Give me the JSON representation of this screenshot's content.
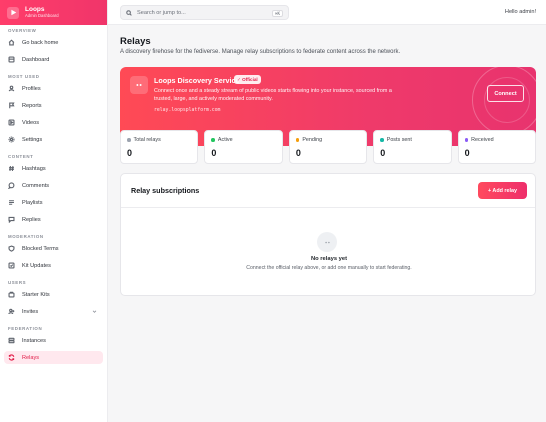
{
  "brand": {
    "title": "Loops",
    "subtitle": "Admin Dashboard"
  },
  "search": {
    "placeholder": "Search or jump to...",
    "shortcut": "⌘K"
  },
  "header": {
    "greeting": "Hello admin!"
  },
  "sidebar": {
    "sections": [
      {
        "label": "OVERVIEW",
        "items": [
          {
            "label": "Go back home",
            "icon": "home-icon"
          },
          {
            "label": "Dashboard",
            "icon": "dashboard-icon"
          }
        ]
      },
      {
        "label": "MOST USED",
        "items": [
          {
            "label": "Profiles",
            "icon": "user-icon"
          },
          {
            "label": "Reports",
            "icon": "report-icon"
          },
          {
            "label": "Videos",
            "icon": "video-icon"
          },
          {
            "label": "Settings",
            "icon": "gear-icon"
          }
        ]
      },
      {
        "label": "CONTENT",
        "items": [
          {
            "label": "Hashtags",
            "icon": "hashtag-icon"
          },
          {
            "label": "Comments",
            "icon": "comment-icon"
          },
          {
            "label": "Playlists",
            "icon": "playlist-icon"
          },
          {
            "label": "Replies",
            "icon": "reply-icon"
          }
        ]
      },
      {
        "label": "MODERATION",
        "items": [
          {
            "label": "Blocked Terms",
            "icon": "block-icon"
          },
          {
            "label": "Kit Updates",
            "icon": "kit-icon"
          }
        ]
      },
      {
        "label": "USERS",
        "items": [
          {
            "label": "Starter Kits",
            "icon": "starter-kit-icon"
          },
          {
            "label": "Invites",
            "icon": "invite-icon"
          }
        ]
      },
      {
        "label": "FEDERATION",
        "items": [
          {
            "label": "Instances",
            "icon": "server-icon"
          },
          {
            "label": "Relays",
            "icon": "relay-icon"
          }
        ]
      }
    ]
  },
  "page": {
    "title": "Relays",
    "description": "A discovery firehose for the fediverse. Manage relay subscriptions to federate content across the network."
  },
  "banner": {
    "title": "Loops Discovery Service",
    "badge": "✓ Official",
    "text": "Connect once and a steady stream of public videos starts flowing into your instance, sourced from a trusted, large, and actively moderated community.",
    "url": "relay.loopsplatform.com",
    "button": "Connect"
  },
  "stats": [
    {
      "label": "Total relays",
      "value": "0",
      "color": "#9ca3af"
    },
    {
      "label": "Active",
      "value": "0",
      "color": "#22c55e"
    },
    {
      "label": "Pending",
      "value": "0",
      "color": "#f59e0b"
    },
    {
      "label": "Posts sent",
      "value": "0",
      "color": "#14b8a6"
    },
    {
      "label": "Received",
      "value": "0",
      "color": "#8b5cf6"
    }
  ],
  "subscriptions": {
    "title": "Relay subscriptions",
    "add_button": "+ Add relay",
    "empty_title": "No relays yet",
    "empty_desc": "Connect the official relay above, or add one manually to start federating."
  },
  "colors": {
    "accent": "#f0356a",
    "active_bg": "#ffe8ee",
    "active_text": "#e11d48"
  }
}
